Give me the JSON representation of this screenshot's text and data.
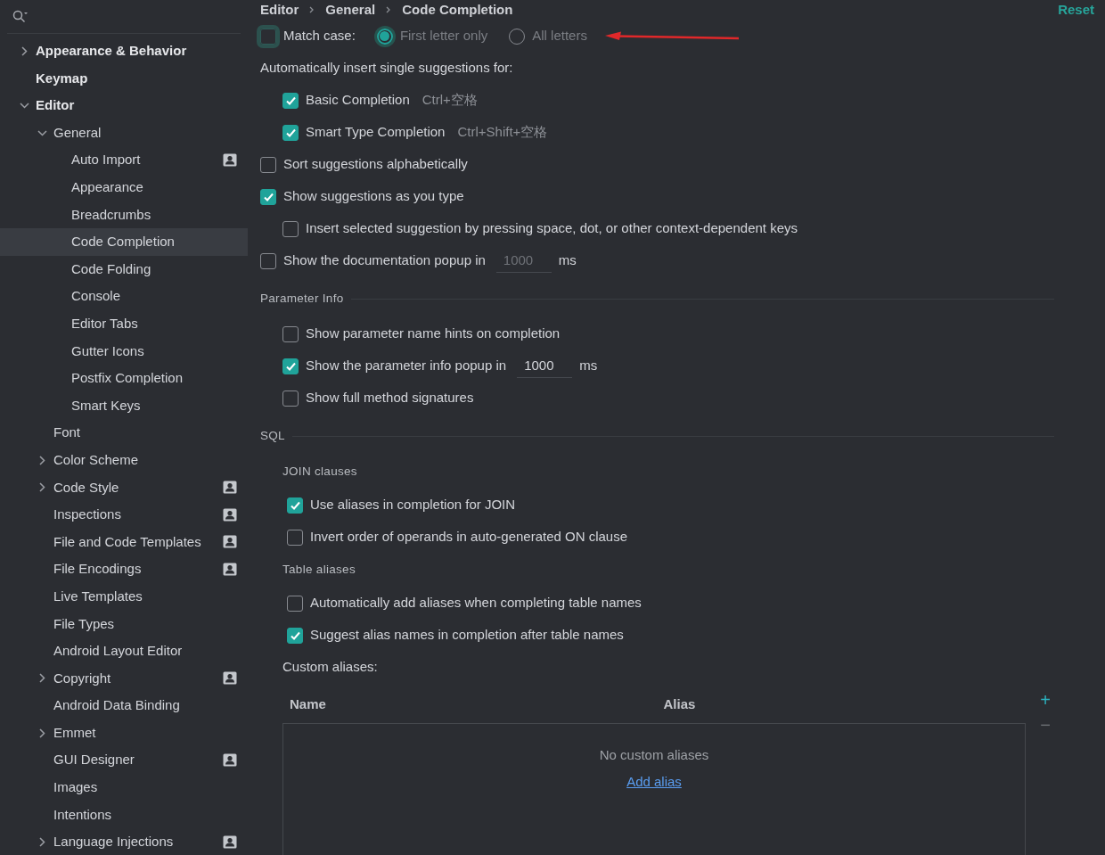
{
  "sidebar": {
    "items": [
      {
        "label": "Appearance & Behavior",
        "bold": true,
        "expanded": false,
        "selected": false,
        "project_level": false
      },
      {
        "label": "Keymap",
        "bold": true,
        "selected": false,
        "project_level": false
      },
      {
        "label": "Editor",
        "bold": true,
        "expanded": true,
        "selected": false,
        "project_level": false,
        "children": [
          {
            "label": "General",
            "bold": false,
            "expanded": true,
            "selected": false,
            "project_level": false,
            "children": [
              {
                "label": "Auto Import",
                "bold": false,
                "selected": false,
                "project_level": true
              },
              {
                "label": "Appearance",
                "bold": false,
                "selected": false,
                "project_level": false
              },
              {
                "label": "Breadcrumbs",
                "bold": false,
                "selected": false,
                "project_level": false
              },
              {
                "label": "Code Completion",
                "bold": false,
                "selected": true,
                "project_level": false
              },
              {
                "label": "Code Folding",
                "bold": false,
                "selected": false,
                "project_level": false
              },
              {
                "label": "Console",
                "bold": false,
                "selected": false,
                "project_level": false
              },
              {
                "label": "Editor Tabs",
                "bold": false,
                "selected": false,
                "project_level": false
              },
              {
                "label": "Gutter Icons",
                "bold": false,
                "selected": false,
                "project_level": false
              },
              {
                "label": "Postfix Completion",
                "bold": false,
                "selected": false,
                "project_level": false
              },
              {
                "label": "Smart Keys",
                "bold": false,
                "selected": false,
                "project_level": false
              }
            ]
          },
          {
            "label": "Font",
            "bold": false,
            "selected": false,
            "project_level": false
          },
          {
            "label": "Color Scheme",
            "bold": false,
            "expanded": false,
            "selected": false,
            "project_level": false
          },
          {
            "label": "Code Style",
            "bold": false,
            "expanded": false,
            "selected": false,
            "project_level": true
          },
          {
            "label": "Inspections",
            "bold": false,
            "selected": false,
            "project_level": true
          },
          {
            "label": "File and Code Templates",
            "bold": false,
            "selected": false,
            "project_level": true
          },
          {
            "label": "File Encodings",
            "bold": false,
            "selected": false,
            "project_level": true
          },
          {
            "label": "Live Templates",
            "bold": false,
            "selected": false,
            "project_level": false
          },
          {
            "label": "File Types",
            "bold": false,
            "selected": false,
            "project_level": false
          },
          {
            "label": "Android Layout Editor",
            "bold": false,
            "selected": false,
            "project_level": false
          },
          {
            "label": "Copyright",
            "bold": false,
            "expanded": false,
            "selected": false,
            "project_level": true
          },
          {
            "label": "Android Data Binding",
            "bold": false,
            "selected": false,
            "project_level": false
          },
          {
            "label": "Emmet",
            "bold": false,
            "expanded": false,
            "selected": false,
            "project_level": false
          },
          {
            "label": "GUI Designer",
            "bold": false,
            "selected": false,
            "project_level": true
          },
          {
            "label": "Images",
            "bold": false,
            "selected": false,
            "project_level": false
          },
          {
            "label": "Intentions",
            "bold": false,
            "selected": false,
            "project_level": false
          },
          {
            "label": "Language Injections",
            "bold": false,
            "expanded": false,
            "selected": false,
            "project_level": true
          }
        ]
      }
    ]
  },
  "breadcrumb": [
    "Editor",
    "General",
    "Code Completion"
  ],
  "reset": "Reset",
  "settings": [
    {
      "kind": "match_case",
      "label": "Match case:",
      "checked": false,
      "focused": true,
      "radios": [
        {
          "label": "First letter only",
          "selected": true,
          "disabled": true
        },
        {
          "label": "All letters",
          "selected": false,
          "disabled": true
        }
      ]
    },
    {
      "kind": "label",
      "text": "Automatically insert single suggestions for:",
      "children": [
        {
          "kind": "checkbox",
          "label": "Basic Completion",
          "checked": true,
          "shortcut": "Ctrl+空格"
        },
        {
          "kind": "checkbox",
          "label": "Smart Type Completion",
          "checked": true,
          "shortcut": "Ctrl+Shift+空格"
        }
      ]
    },
    {
      "kind": "checkbox",
      "label": "Sort suggestions alphabetically",
      "checked": false
    },
    {
      "kind": "checkbox",
      "label": "Show suggestions as you type",
      "checked": true,
      "children": [
        {
          "kind": "checkbox",
          "label": "Insert selected suggestion by pressing space, dot, or other context-dependent keys",
          "checked": false
        }
      ]
    },
    {
      "kind": "checkbox_number",
      "label": "Show the documentation popup in",
      "checked": false,
      "value": "1000",
      "unit": "ms",
      "disabled": true
    },
    {
      "kind": "section",
      "title": "Parameter Info",
      "children": [
        {
          "kind": "checkbox",
          "label": "Show parameter name hints on completion",
          "checked": false
        },
        {
          "kind": "checkbox_number",
          "label": "Show the parameter info popup in",
          "checked": true,
          "value": "1000",
          "unit": "ms",
          "disabled": false
        },
        {
          "kind": "checkbox",
          "label": "Show full method signatures",
          "checked": false
        }
      ]
    },
    {
      "kind": "section",
      "title": "SQL",
      "children": [
        {
          "kind": "subsection",
          "title": "JOIN clauses",
          "children": [
            {
              "kind": "checkbox",
              "label": "Use aliases in completion for JOIN",
              "checked": true
            },
            {
              "kind": "checkbox",
              "label": "Invert order of operands in auto-generated ON clause",
              "checked": false
            }
          ]
        },
        {
          "kind": "subsection",
          "title": "Table aliases",
          "children": [
            {
              "kind": "checkbox",
              "label": "Automatically add aliases when completing table names",
              "checked": false
            },
            {
              "kind": "checkbox",
              "label": "Suggest alias names in completion after table names",
              "checked": true
            }
          ]
        },
        {
          "kind": "label",
          "text": "Custom aliases:"
        },
        {
          "kind": "table",
          "columns": [
            "Name",
            "Alias"
          ],
          "empty_text": "No custom aliases",
          "link": "Add alias",
          "toolbar": [
            {
              "label": "+",
              "disabled": false
            },
            {
              "label": "−",
              "disabled": true
            }
          ]
        }
      ]
    }
  ]
}
